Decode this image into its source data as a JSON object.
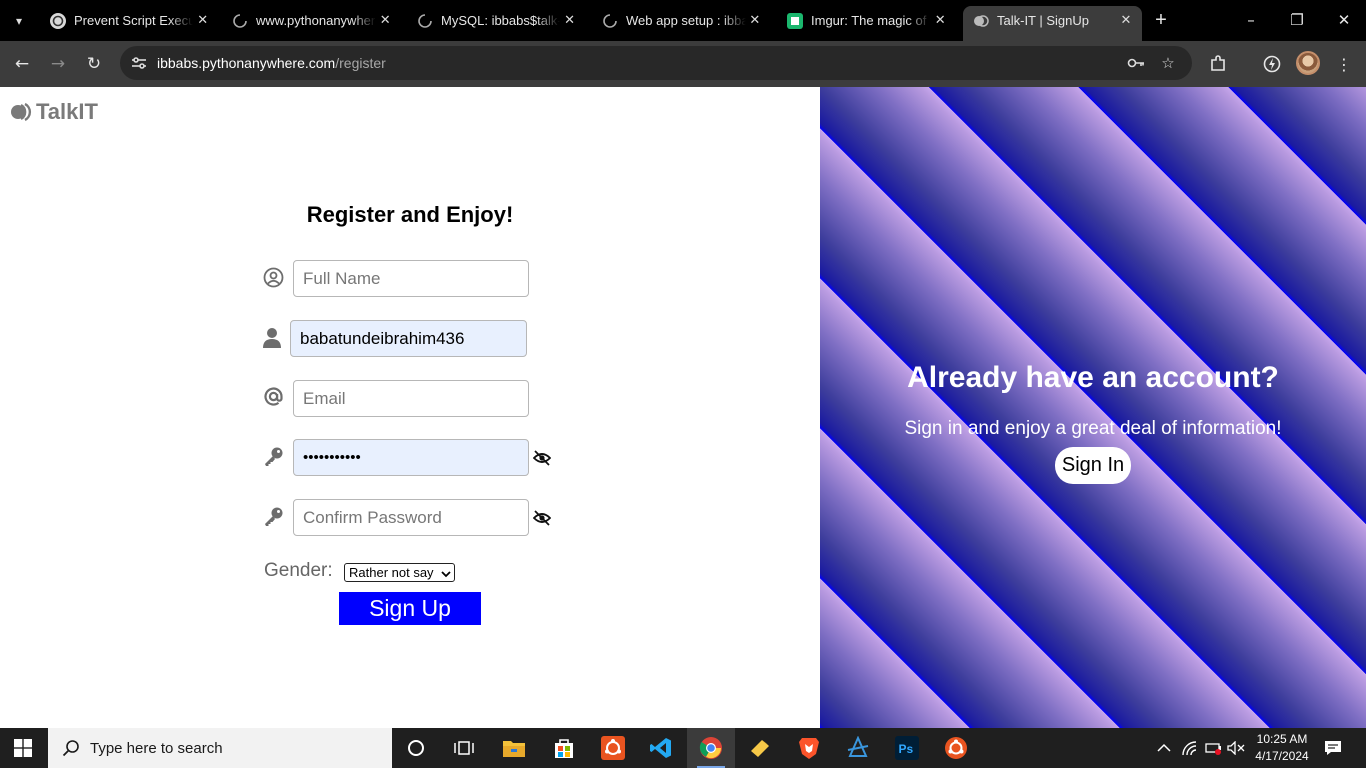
{
  "browser": {
    "tabs": [
      {
        "title": "Prevent Script Executi",
        "active": false
      },
      {
        "title": "www.pythonanywhere.c",
        "active": false
      },
      {
        "title": "MySQL: ibbabs$talk-it",
        "active": false
      },
      {
        "title": "Web app setup : ibbab",
        "active": false
      },
      {
        "title": "Imgur: The magic of the",
        "active": false
      },
      {
        "title": "Talk-IT | SignUp",
        "active": true
      }
    ],
    "url_host": "ibbabs.pythonanywhere.com",
    "url_path": "/register"
  },
  "page": {
    "logo_text": "TalkIT",
    "form": {
      "title": "Register and Enjoy!",
      "full_name_placeholder": "Full Name",
      "username_value": "babatundeibrahim436",
      "email_placeholder": "Email",
      "password_value": "•••••••••••",
      "confirm_password_placeholder": "Confirm Password",
      "gender_label": "Gender:",
      "gender_selected": "Rather not say",
      "submit_label": "Sign Up"
    },
    "promo": {
      "title": "Already have an account?",
      "subtitle": "Sign in and enjoy a great deal of information!",
      "signin_label": "Sign In"
    }
  },
  "taskbar": {
    "search_placeholder": "Type here to search",
    "time": "10:25 AM",
    "date": "4/17/2024"
  },
  "colors": {
    "signup_button": "#0000ff",
    "promo_stripe_dark": "#0000ff",
    "promo_stripe_light": "#c6a6ec",
    "autofill_bg": "#e8f0fe"
  }
}
